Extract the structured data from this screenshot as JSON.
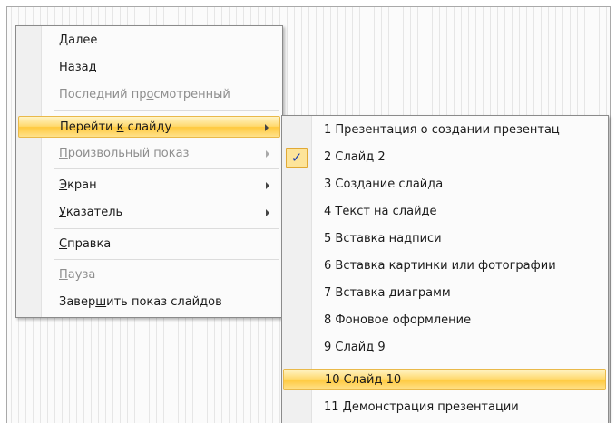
{
  "context_menu": {
    "items": [
      {
        "pre": "",
        "u": "Д",
        "post": "алее",
        "disabled": false,
        "submenu": false
      },
      {
        "pre": "",
        "u": "Н",
        "post": "азад",
        "disabled": false,
        "submenu": false
      },
      {
        "pre": "Последний пр",
        "u": "о",
        "post": "смотренный",
        "disabled": true,
        "submenu": false
      },
      {
        "pre": "Перейти ",
        "u": "к",
        "post": " слайду",
        "disabled": false,
        "submenu": true,
        "highlighted": true
      },
      {
        "pre": "",
        "u": "П",
        "post": "роизвольный показ",
        "disabled": true,
        "submenu": true
      },
      {
        "pre": "",
        "u": "Э",
        "post": "кран",
        "disabled": false,
        "submenu": true
      },
      {
        "pre": "",
        "u": "У",
        "post": "казатель",
        "disabled": false,
        "submenu": true
      },
      {
        "pre": "",
        "u": "С",
        "post": "правка",
        "disabled": false,
        "submenu": false
      },
      {
        "pre": "",
        "u": "П",
        "post": "ауза",
        "disabled": true,
        "submenu": false
      },
      {
        "pre": "Завер",
        "u": "ш",
        "post": "ить показ слайдов",
        "disabled": false,
        "submenu": false
      }
    ]
  },
  "submenu": {
    "check_glyph": "✓",
    "slides": [
      "1 Презентация о создании презентац",
      "2 Слайд 2",
      "3 Создание слайда",
      "4 Текст на слайде",
      "5 Вставка надписи",
      "6 Вставка картинки или фотографии",
      "7 Вставка диаграмм",
      "8 Фоновое оформление",
      "9 Слайд 9",
      "10 Слайд 10",
      "11 Демонстрация презентации"
    ],
    "checked_index": 1,
    "highlighted_index": 9
  },
  "colors": {
    "highlight": "#ffd96e",
    "check": "#1a3eb0",
    "disabled_text": "#8e8e8e"
  }
}
